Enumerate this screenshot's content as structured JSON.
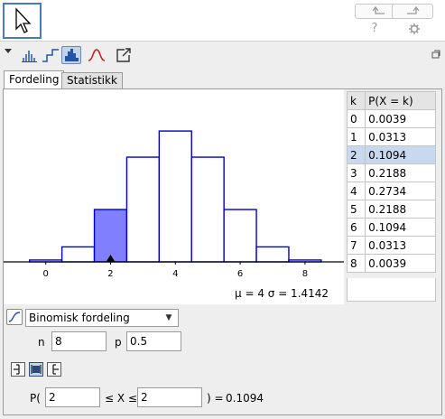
{
  "toolbar": {
    "undo_icon": "undo-icon",
    "redo_icon": "redo-icon",
    "help_label": "?",
    "settings_icon": "gear-icon"
  },
  "tabs": [
    {
      "label": "Fordeling",
      "active": true
    },
    {
      "label": "Statistikk",
      "active": false
    }
  ],
  "chart_data": {
    "type": "bar",
    "x": [
      0,
      1,
      2,
      3,
      4,
      5,
      6,
      7,
      8
    ],
    "values": [
      0.0039,
      0.0313,
      0.1094,
      0.2188,
      0.2734,
      0.2188,
      0.1094,
      0.0313,
      0.0039
    ],
    "highlight": [
      2
    ],
    "x_ticks": [
      "0",
      "2",
      "4",
      "6",
      "8"
    ],
    "xlim": [
      -1.3,
      9.2
    ],
    "ylim": [
      0,
      0.3
    ],
    "colors": {
      "bar_stroke": "#0000cc",
      "highlight_fill": "#8080ff"
    },
    "marker_x": 2
  },
  "stats": {
    "text": "μ = 4   σ = 1.4142"
  },
  "table": {
    "header_k": "k",
    "header_p": "P(X = k)",
    "selected_row": 2,
    "rows": [
      {
        "k": "0",
        "p": "0.0039"
      },
      {
        "k": "1",
        "p": "0.0313"
      },
      {
        "k": "2",
        "p": "0.1094"
      },
      {
        "k": "3",
        "p": "0.2188"
      },
      {
        "k": "4",
        "p": "0.2734"
      },
      {
        "k": "5",
        "p": "0.2188"
      },
      {
        "k": "6",
        "p": "0.1094"
      },
      {
        "k": "7",
        "p": "0.0313"
      },
      {
        "k": "8",
        "p": "0.0039"
      }
    ]
  },
  "distribution": {
    "selected": "Binomisk fordeling"
  },
  "params": {
    "n_label": "n",
    "n_value": "8",
    "p_label": "p",
    "p_value": "0.5"
  },
  "probability": {
    "prefix": "P(",
    "low": "2",
    "middle": "≤ X ≤",
    "high": "2",
    "suffix": ")  =",
    "result": "0.1094"
  }
}
